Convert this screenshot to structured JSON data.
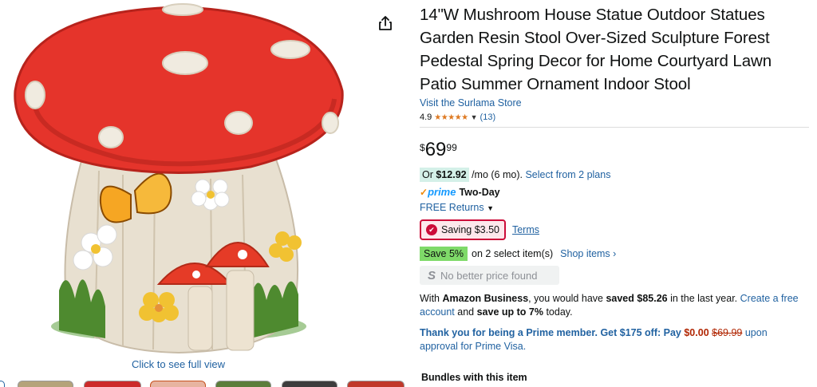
{
  "product": {
    "title": "14\"W Mushroom House Statue Outdoor Statues Garden Resin Stool Over-Sized Sculpture Forest Pedestal Spring Decor for Home Courtyard Lawn Patio Summer Ornament Indoor Stool",
    "store_link": "Visit the Surlama Store",
    "rating": "4.9",
    "stars": "★★★★★",
    "rating_count": "(13)"
  },
  "price": {
    "symbol": "$",
    "whole": "69",
    "fraction": "99"
  },
  "monthly": {
    "or": "Or ",
    "amount": "$12.92",
    "suffix": "/mo (6 mo).",
    "plans": "Select from 2 plans"
  },
  "prime": {
    "check": "✓",
    "logo": "prime",
    "delivery": "Two-Day"
  },
  "returns": {
    "label": "FREE Returns"
  },
  "saving": {
    "label": "Saving $3.50",
    "terms": "Terms"
  },
  "save5": {
    "badge": "Save 5%",
    "text": "on 2 select item(s)",
    "link": "Shop items ›"
  },
  "nobetter": {
    "text": "No better price found"
  },
  "business": {
    "t1": "With ",
    "b1": "Amazon Business",
    "t2": ", you would have ",
    "b2": "saved $85.26",
    "t3": " in the last year. ",
    "link": "Create a free account",
    "t4": " and ",
    "b3": "save up to 7%",
    "t5": " today."
  },
  "prime_visa": {
    "b1": "Thank you for being a Prime member. Get $175 off: Pay ",
    "red": "$0.00",
    "strike": "$69.99",
    "t1": " upon approval for Prime Visa."
  },
  "gallery": {
    "full_view": "Click to see full view"
  },
  "bundles": {
    "heading": "Bundles with this item"
  },
  "colors": {
    "link": "#2162a1",
    "price_red": "#b12704",
    "saving_border": "#cc0c39",
    "save_green": "#7fda69",
    "prime_blue": "#1399ff"
  }
}
